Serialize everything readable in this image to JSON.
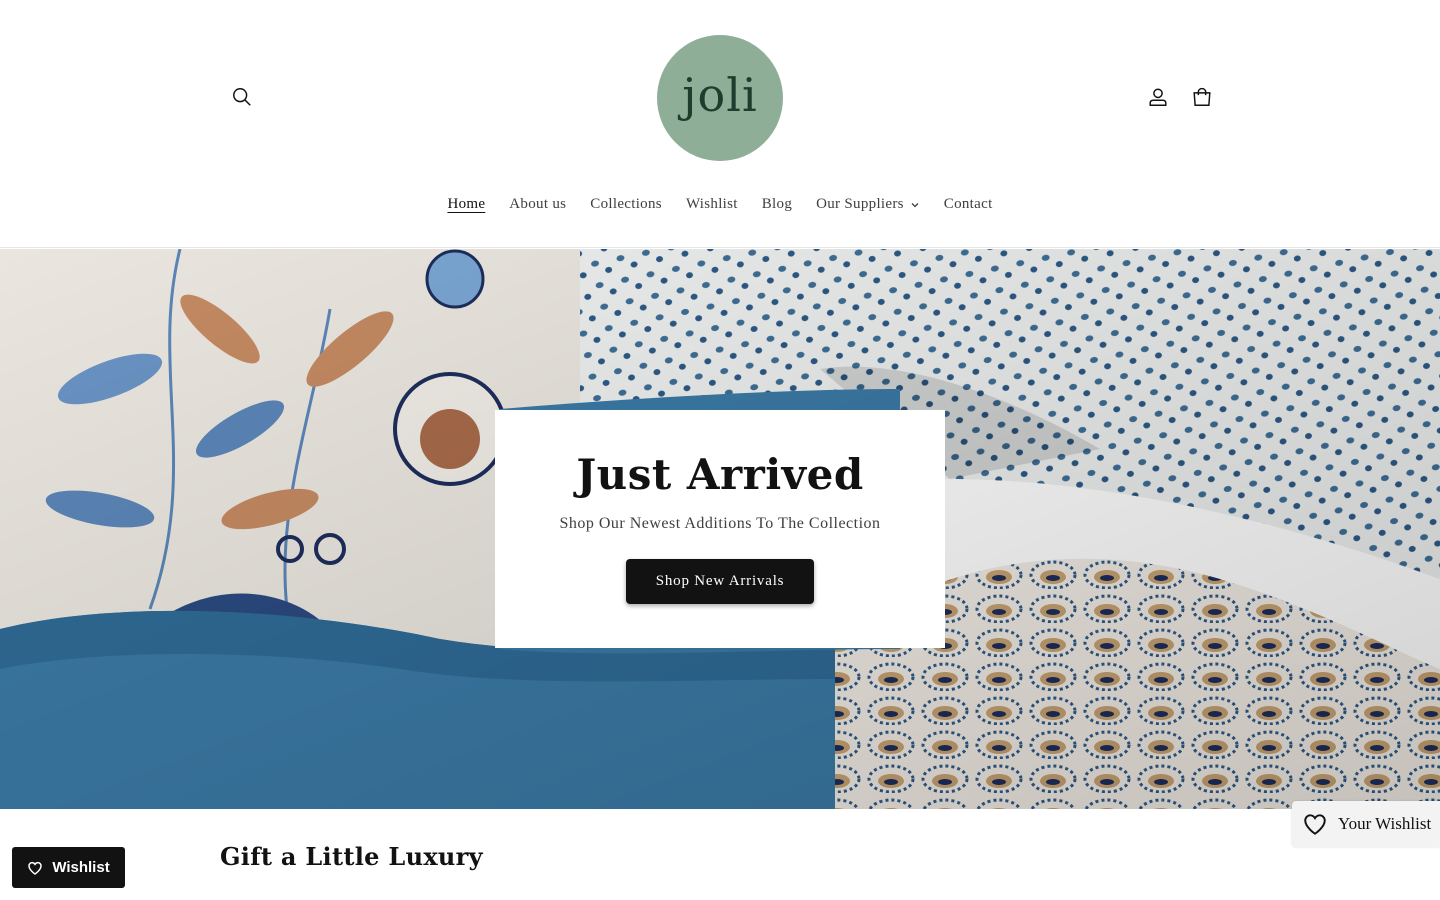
{
  "brand": {
    "logo_text": "joli",
    "logo_color": "#8fae98"
  },
  "header": {
    "search_icon": "search-icon",
    "account_icon": "account-icon",
    "cart_icon": "cart-icon"
  },
  "nav": {
    "items": [
      {
        "label": "Home",
        "active": true
      },
      {
        "label": "About us"
      },
      {
        "label": "Collections"
      },
      {
        "label": "Wishlist"
      },
      {
        "label": "Blog"
      },
      {
        "label": "Our Suppliers",
        "has_dropdown": true
      },
      {
        "label": "Contact"
      }
    ]
  },
  "hero": {
    "title": "Just Arrived",
    "subtitle": "Shop Our Newest Additions To The Collection",
    "button_label": "Shop New Arrivals"
  },
  "section": {
    "title": "Gift a Little Luxury"
  },
  "wishlist_button": {
    "label": "Wishlist"
  },
  "your_wishlist": {
    "label": "Your Wishlist"
  }
}
